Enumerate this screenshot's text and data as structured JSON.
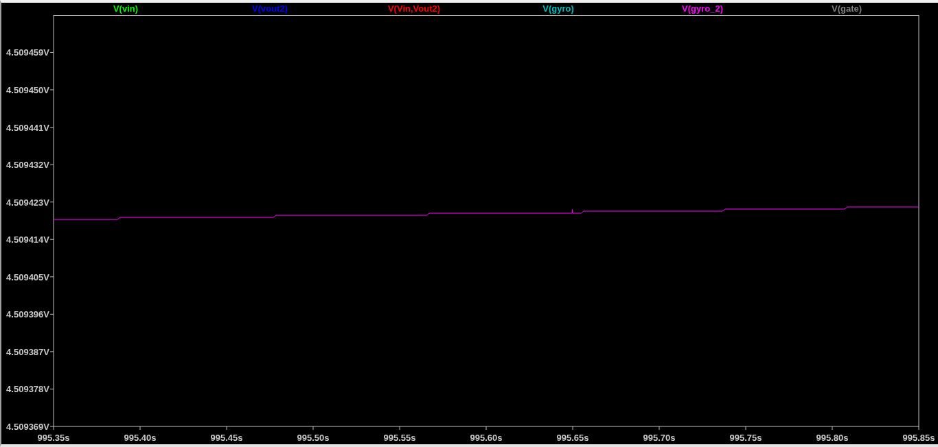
{
  "chart_data": {
    "type": "line",
    "x": [
      995.35,
      995.3869,
      995.3885,
      995.477,
      995.4786,
      995.5655,
      995.5671,
      995.6496,
      995.6498,
      995.65,
      995.6548,
      995.6564,
      995.7365,
      995.7381,
      995.8071,
      995.8087,
      995.85
    ],
    "series": [
      {
        "name": "V(vin)",
        "color": "#00ff00",
        "values": [
          null,
          null,
          null,
          null,
          null,
          null,
          null,
          null,
          null,
          null,
          null,
          null,
          null,
          null,
          null,
          null,
          null
        ]
      },
      {
        "name": "V(vout2)",
        "color": "#0000ff",
        "values": [
          null,
          null,
          null,
          null,
          null,
          null,
          null,
          null,
          null,
          null,
          null,
          null,
          null,
          null,
          null,
          null,
          null
        ]
      },
      {
        "name": "V(Vin,Vout2)",
        "color": "#ff0000",
        "values": [
          null,
          null,
          null,
          null,
          null,
          null,
          null,
          null,
          null,
          null,
          null,
          null,
          null,
          null,
          null,
          null,
          null
        ]
      },
      {
        "name": "V(gyro)",
        "color": "#00c0c0",
        "values": [
          null,
          null,
          null,
          null,
          null,
          null,
          null,
          null,
          null,
          null,
          null,
          null,
          null,
          null,
          null,
          null,
          null
        ]
      },
      {
        "name": "V(gyro_2)",
        "color": "#ff00ff",
        "values": [
          4.5094188,
          4.5094188,
          4.5094193,
          4.5094193,
          4.5094198,
          4.5094198,
          4.5094203,
          4.5094203,
          4.5094212,
          4.5094203,
          4.5094203,
          4.5094208,
          4.5094208,
          4.5094213,
          4.5094213,
          4.5094218,
          4.5094218
        ]
      },
      {
        "name": "V(gate)",
        "color": "#808080",
        "values": [
          null,
          null,
          null,
          null,
          null,
          null,
          null,
          null,
          null,
          null,
          null,
          null,
          null,
          null,
          null,
          null,
          null
        ]
      }
    ],
    "xlim": [
      995.35,
      995.85
    ],
    "ylim": [
      4.509369,
      4.5094679
    ],
    "xticks": [
      {
        "value": 995.35,
        "label": "995.35s"
      },
      {
        "value": 995.4,
        "label": "995.40s"
      },
      {
        "value": 995.45,
        "label": "995.45s"
      },
      {
        "value": 995.5,
        "label": "995.50s"
      },
      {
        "value": 995.55,
        "label": "995.55s"
      },
      {
        "value": 995.6,
        "label": "995.60s"
      },
      {
        "value": 995.65,
        "label": "995.65s"
      },
      {
        "value": 995.7,
        "label": "995.70s"
      },
      {
        "value": 995.75,
        "label": "995.75s"
      },
      {
        "value": 995.8,
        "label": "995.80s"
      },
      {
        "value": 995.85,
        "label": "995.85s"
      }
    ],
    "yticks": [
      {
        "value": 4.509369,
        "label": "4.509369V"
      },
      {
        "value": 4.509378,
        "label": "4.509378V"
      },
      {
        "value": 4.509387,
        "label": "4.509387V"
      },
      {
        "value": 4.509396,
        "label": "4.509396V"
      },
      {
        "value": 4.509405,
        "label": "4.509405V"
      },
      {
        "value": 4.509414,
        "label": "4.509414V"
      },
      {
        "value": 4.509423,
        "label": "4.509423V"
      },
      {
        "value": 4.509432,
        "label": "4.509432V"
      },
      {
        "value": 4.509441,
        "label": "4.509441V"
      },
      {
        "value": 4.50945,
        "label": "4.509450V"
      },
      {
        "value": 4.509459,
        "label": "4.509459V"
      }
    ]
  }
}
